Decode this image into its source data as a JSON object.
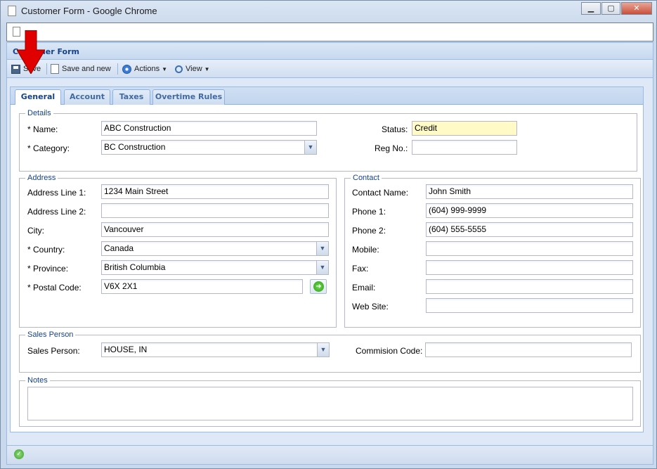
{
  "window": {
    "title": "Customer Form - Google Chrome",
    "minimize": "▁",
    "maximize": "▢",
    "close": "✕"
  },
  "panel": {
    "title": "Customer Form"
  },
  "toolbar": {
    "save": "Save",
    "save_and_new": "Save and new",
    "actions": "Actions",
    "view": "View"
  },
  "tabs": [
    "General",
    "Account",
    "Taxes",
    "Overtime Rules"
  ],
  "details": {
    "legend": "Details",
    "name_label": "* Name:",
    "name_value": "ABC Construction",
    "category_label": "* Category:",
    "category_value": "BC Construction",
    "status_label": "Status:",
    "status_value": "Credit",
    "regno_label": "Reg No.:",
    "regno_value": ""
  },
  "address": {
    "legend": "Address",
    "line1_label": "Address Line 1:",
    "line1_value": "1234 Main Street",
    "line2_label": "Address Line 2:",
    "line2_value": "",
    "city_label": "City:",
    "city_value": "Vancouver",
    "country_label": "* Country:",
    "country_value": "Canada",
    "province_label": "* Province:",
    "province_value": "British Columbia",
    "postal_label": "* Postal Code:",
    "postal_value": "V6X 2X1"
  },
  "contact": {
    "legend": "Contact",
    "name_label": "Contact Name:",
    "name_value": "John Smith",
    "phone1_label": "Phone 1:",
    "phone1_value": "(604) 999-9999",
    "phone2_label": "Phone 2:",
    "phone2_value": "(604) 555-5555",
    "mobile_label": "Mobile:",
    "mobile_value": "",
    "fax_label": "Fax:",
    "fax_value": "",
    "email_label": "Email:",
    "email_value": "",
    "website_label": "Web Site:",
    "website_value": ""
  },
  "sales": {
    "legend": "Sales Person",
    "person_label": "Sales Person:",
    "person_value": "HOUSE, IN",
    "commission_label": "Commision Code:",
    "commission_value": ""
  },
  "notes": {
    "legend": "Notes",
    "value": ""
  },
  "icons": {
    "dropdown": "▼",
    "go": "➜",
    "ok": "✓"
  },
  "colors": {
    "arrow": "#e00000",
    "status_field": "#fffac6",
    "header_text": "#15428b"
  }
}
